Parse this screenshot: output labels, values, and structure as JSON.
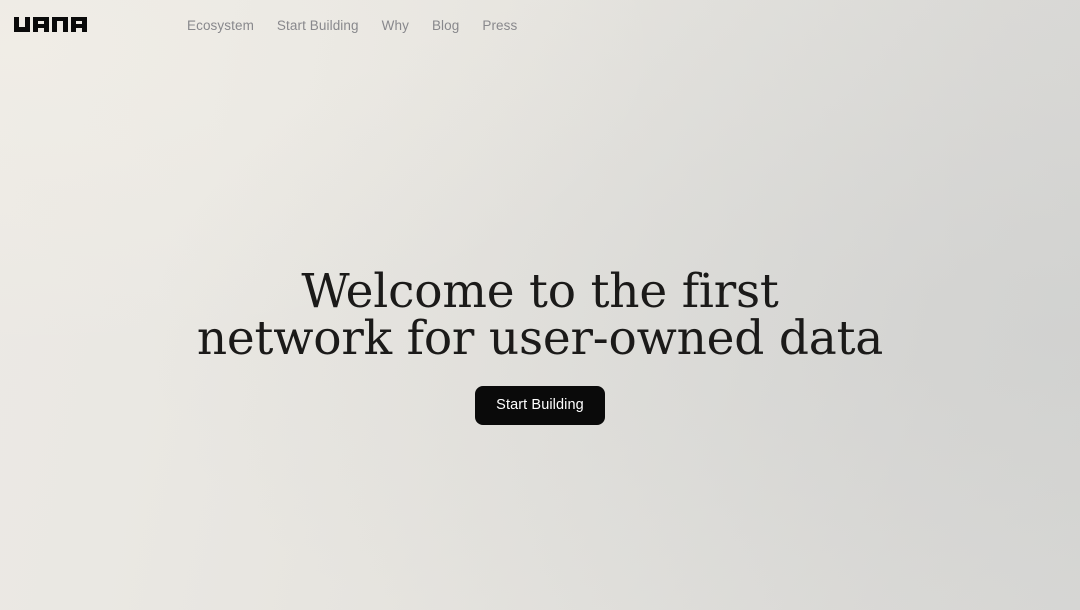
{
  "site": {
    "brand": "vana",
    "brand_icon": "vana-wordmark-logo"
  },
  "nav": {
    "items": [
      {
        "label": "Ecosystem"
      },
      {
        "label": "Start Building"
      },
      {
        "label": "Why"
      },
      {
        "label": "Blog"
      },
      {
        "label": "Press"
      }
    ]
  },
  "hero": {
    "headline_line_1": "Welcome to the first",
    "headline_line_2": "network for user-owned data",
    "cta_label": "Start Building"
  },
  "colors": {
    "background_start": "#ece9e4",
    "background_end": "#d8d8d5",
    "headline_text": "#1b1a19",
    "nav_text": "#88888c",
    "button_background": "#0a0a0a",
    "button_text": "#ffffff",
    "logo": "#0a0a0a"
  }
}
